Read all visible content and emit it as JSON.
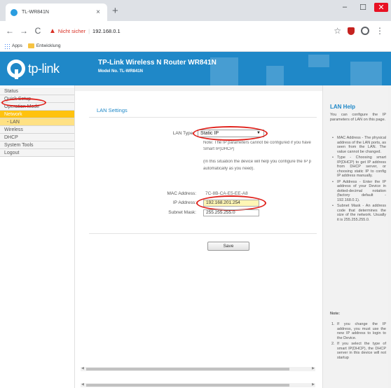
{
  "browser": {
    "tab_title": "TL-WR841N",
    "tab_close": "×",
    "new_tab": "+",
    "window_controls": {
      "minimize": "–",
      "maximize": "☐",
      "close": "✕"
    },
    "nav": {
      "back": "←",
      "forward": "→",
      "reload": "C"
    },
    "security_text": "Nicht sicher",
    "url": "192.168.0.1",
    "bookmarks": {
      "apps": "Apps",
      "folder": "Entwicklung"
    }
  },
  "header": {
    "logo_text": "tp-link",
    "title": "TP-Link Wireless N Router WR841N",
    "model": "Model No. TL-WR841N",
    "color": "#1f88c8"
  },
  "menu": {
    "items": [
      "Status",
      "Quick Setup",
      "Operation Mode",
      "Network",
      "- LAN",
      "Wireless",
      "DHCP",
      "System Tools",
      "Logout"
    ],
    "active_color": "#ffc20e"
  },
  "main": {
    "section_title": "LAN Settings",
    "lan_type_label": "LAN Type:",
    "lan_type_value": "Static IP",
    "note1": "Note: The IP parameters cannot be configured if you have",
    "note2": "Smart IP(DHCP)",
    "note3": "(In this situation the device will help you configure the IP p",
    "note4": "automatically as you need).",
    "mac_label": "MAC Address:",
    "mac_value": "7C-8B-CA-E5-EE-A8",
    "ip_label": "IP Address:",
    "ip_value": "192.168.201.254",
    "mask_label": "Subnet Mask:",
    "mask_value": "255.255.255.0",
    "save_label": "Save"
  },
  "help": {
    "title": "LAN Help",
    "intro": "You can configure the IP parameters of LAN on this page.",
    "items": [
      "MAC Address - The physical address of the LAN ports, as seen from the LAN. The value cannot be changed.",
      "Type - Choosing smart IP(DHCP) to get IP address from DHCP server, or choosing static IP to config IP address manually.",
      "IP Address - Enter the IP address of your Device in dotted-decimal notation (factory default - 192.168.0.1).",
      "Subnet Mask - An address code that determines the size of the network. Usually it is 255.255.255.0."
    ],
    "note_label": "Note:",
    "notes": [
      "If you change the IP address, you must use the new IP address to login to the Device.",
      "If you select the type of smart IP(DHCP), the DHCP server in this device will not startup"
    ]
  }
}
